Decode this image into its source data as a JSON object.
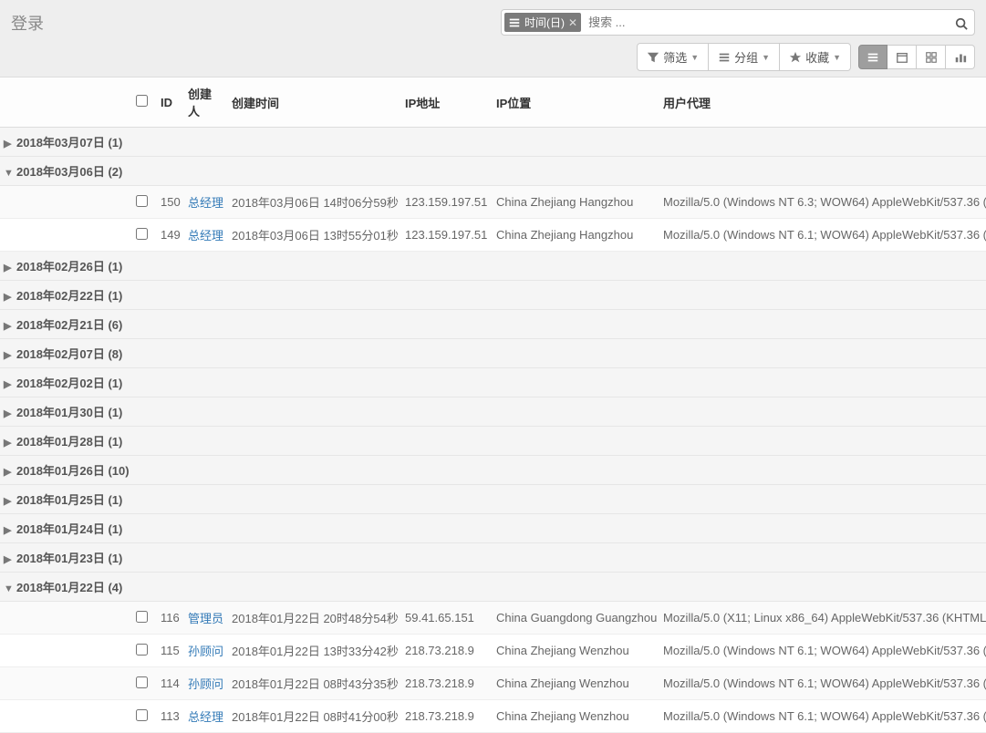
{
  "title": "登录",
  "search": {
    "chip_label": "时间(日)",
    "placeholder": "搜索 ..."
  },
  "toolbar": {
    "filter": "筛选",
    "group": "分组",
    "favorite": "收藏"
  },
  "columns": {
    "id": "ID",
    "creator": "创建人",
    "created_time": "创建时间",
    "ip_address": "IP地址",
    "ip_location": "IP位置",
    "user_agent": "用户代理"
  },
  "groups": [
    {
      "label": "2018年03月07日 (1)",
      "expanded": false,
      "rows": []
    },
    {
      "label": "2018年03月06日 (2)",
      "expanded": true,
      "rows": [
        {
          "id": "150",
          "creator": "总经理",
          "time": "2018年03月06日 14时06分59秒",
          "ip": "123.159.197.51",
          "loc": "China Zhejiang Hangzhou",
          "ua": "Mozilla/5.0 (Windows NT 6.3; WOW64) AppleWebKit/537.36 ("
        },
        {
          "id": "149",
          "creator": "总经理",
          "time": "2018年03月06日 13时55分01秒",
          "ip": "123.159.197.51",
          "loc": "China Zhejiang Hangzhou",
          "ua": "Mozilla/5.0 (Windows NT 6.1; WOW64) AppleWebKit/537.36 ("
        }
      ]
    },
    {
      "label": "2018年02月26日 (1)",
      "expanded": false,
      "rows": []
    },
    {
      "label": "2018年02月22日 (1)",
      "expanded": false,
      "rows": []
    },
    {
      "label": "2018年02月21日 (6)",
      "expanded": false,
      "rows": []
    },
    {
      "label": "2018年02月07日 (8)",
      "expanded": false,
      "rows": []
    },
    {
      "label": "2018年02月02日 (1)",
      "expanded": false,
      "rows": []
    },
    {
      "label": "2018年01月30日 (1)",
      "expanded": false,
      "rows": []
    },
    {
      "label": "2018年01月28日 (1)",
      "expanded": false,
      "rows": []
    },
    {
      "label": "2018年01月26日 (10)",
      "expanded": false,
      "rows": []
    },
    {
      "label": "2018年01月25日 (1)",
      "expanded": false,
      "rows": []
    },
    {
      "label": "2018年01月24日 (1)",
      "expanded": false,
      "rows": []
    },
    {
      "label": "2018年01月23日 (1)",
      "expanded": false,
      "rows": []
    },
    {
      "label": "2018年01月22日 (4)",
      "expanded": true,
      "rows": [
        {
          "id": "116",
          "creator": "管理员",
          "time": "2018年01月22日 20时48分54秒",
          "ip": "59.41.65.151",
          "loc": "China Guangdong Guangzhou",
          "ua": "Mozilla/5.0 (X11; Linux x86_64) AppleWebKit/537.36 (KHTML"
        },
        {
          "id": "115",
          "creator": "孙顾问",
          "time": "2018年01月22日 13时33分42秒",
          "ip": "218.73.218.9",
          "loc": "China Zhejiang Wenzhou",
          "ua": "Mozilla/5.0 (Windows NT 6.1; WOW64) AppleWebKit/537.36 ("
        },
        {
          "id": "114",
          "creator": "孙顾问",
          "time": "2018年01月22日 08时43分35秒",
          "ip": "218.73.218.9",
          "loc": "China Zhejiang Wenzhou",
          "ua": "Mozilla/5.0 (Windows NT 6.1; WOW64) AppleWebKit/537.36 ("
        },
        {
          "id": "113",
          "creator": "总经理",
          "time": "2018年01月22日 08时41分00秒",
          "ip": "218.73.218.9",
          "loc": "China Zhejiang Wenzhou",
          "ua": "Mozilla/5.0 (Windows NT 6.1; WOW64) AppleWebKit/537.36 ("
        }
      ]
    }
  ]
}
